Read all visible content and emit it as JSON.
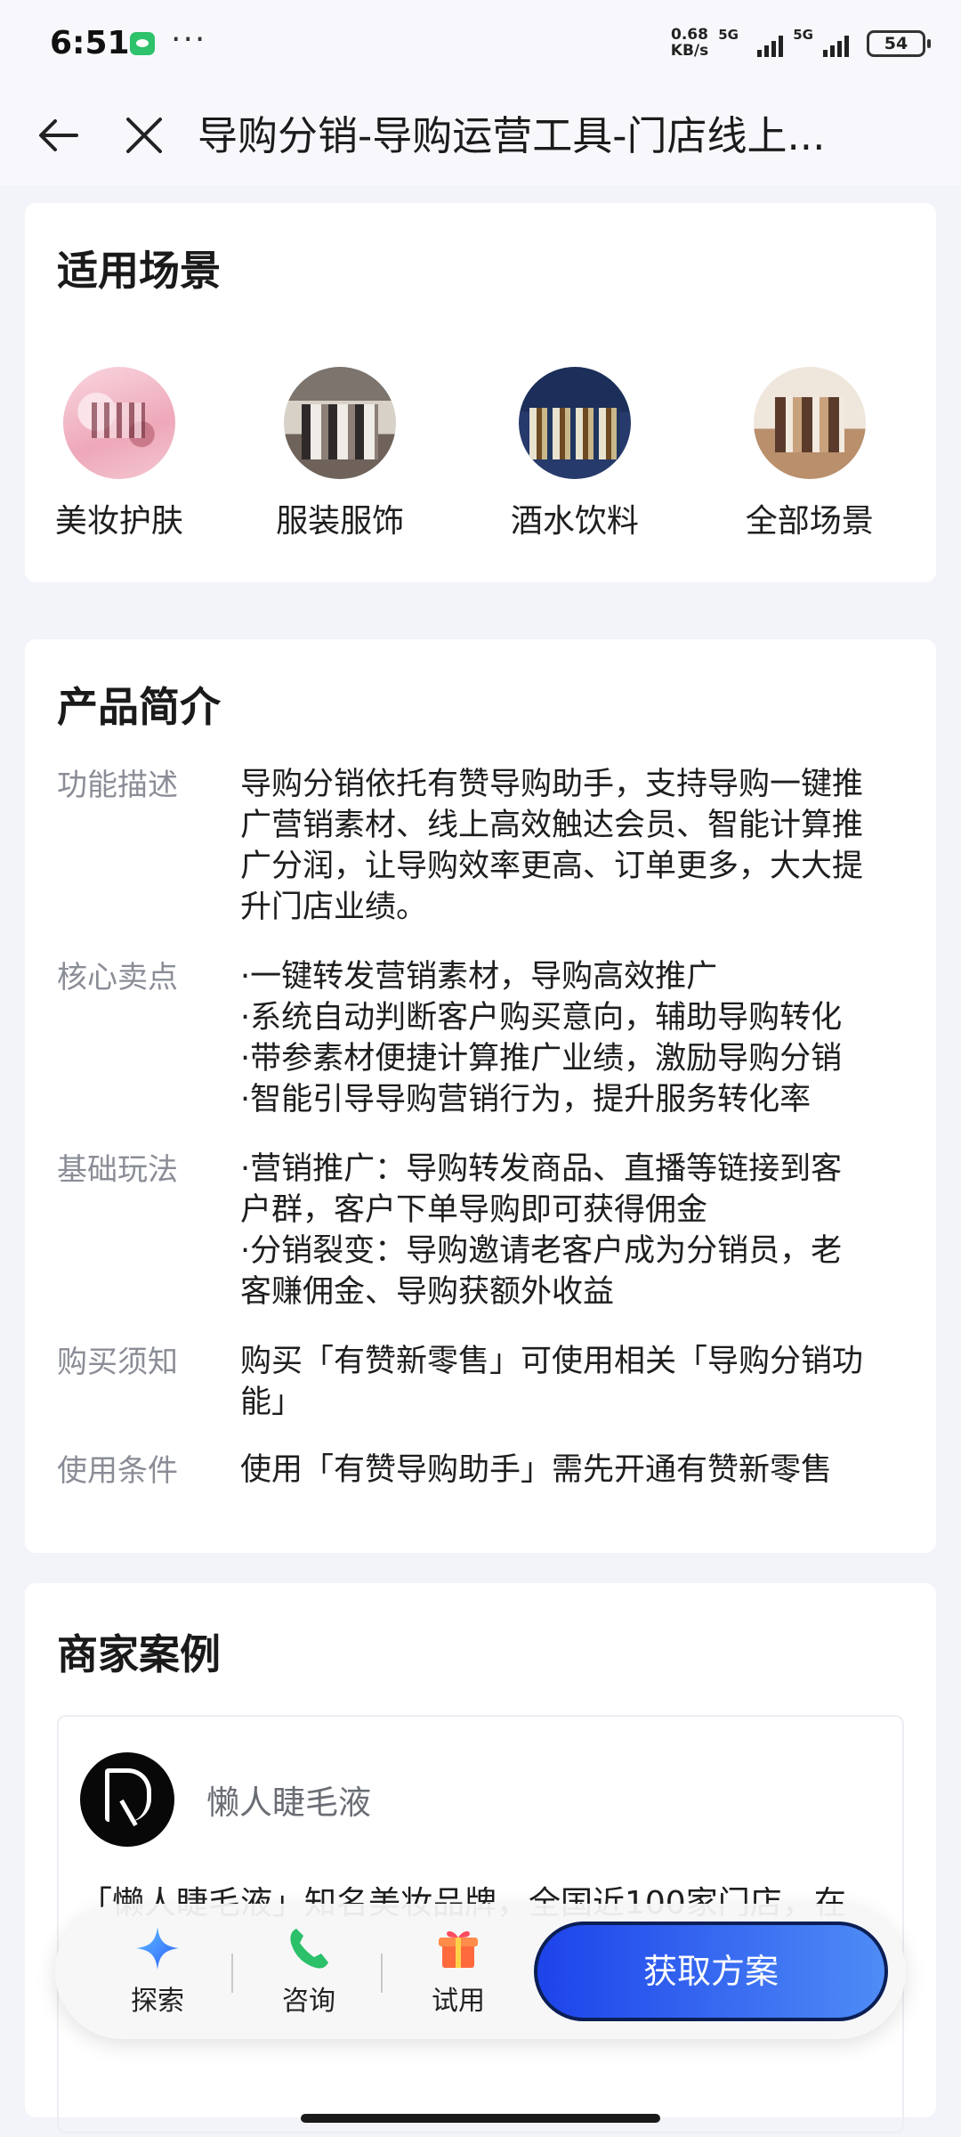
{
  "status_bar": {
    "time": "6:51",
    "net_speed_value": "0.68",
    "net_speed_unit": "KB/s",
    "network_1": "5G",
    "network_2": "5G",
    "battery": "54"
  },
  "nav": {
    "title": "导购分销-导购运营工具-门店线上..."
  },
  "scenes": {
    "title": "适用场景",
    "items": [
      {
        "label": "美妆护肤"
      },
      {
        "label": "服装服饰"
      },
      {
        "label": "酒水饮料"
      },
      {
        "label": "全部场景"
      }
    ]
  },
  "intro": {
    "title": "产品简介",
    "rows": [
      {
        "key": "功能描述",
        "lines": [
          "导购分销依托有赞导购助手，支持导购一键推",
          "广营销素材、线上高效触达会员、智能计算推",
          "广分润，让导购效率更高、订单更多，大大提",
          "升门店业绩。"
        ]
      },
      {
        "key": "核心卖点",
        "lines": [
          "·一键转发营销素材，导购高效推广",
          "·系统自动判断客户购买意向，辅助导购转化",
          "·带参素材便捷计算推广业绩，激励导购分销",
          "·智能引导导购营销行为，提升服务转化率"
        ]
      },
      {
        "key": "基础玩法",
        "lines": [
          "·营销推广：导购转发商品、直播等链接到客",
          "户群，客户下单导购即可获得佣金",
          "·分销裂变：导购邀请老客户成为分销员，老",
          "客赚佣金、导购获额外收益"
        ]
      },
      {
        "key": "购买须知",
        "lines": [
          "购买「有赞新零售」可使用相关「导购分销功",
          "能」"
        ]
      },
      {
        "key": "使用条件",
        "lines": [
          "使用「有赞导购助手」需先开通有赞新零售"
        ]
      }
    ]
  },
  "cases": {
    "title": "商家案例",
    "brand": "懒人睫毛液",
    "description": "「懒人睫毛液」知名美妆品牌，全国近100家门店，在"
  },
  "action_bar": {
    "explore": "探索",
    "consult": "咨询",
    "trial": "试用",
    "cta": "获取方案",
    "cta_color": "#2f5cf0"
  }
}
